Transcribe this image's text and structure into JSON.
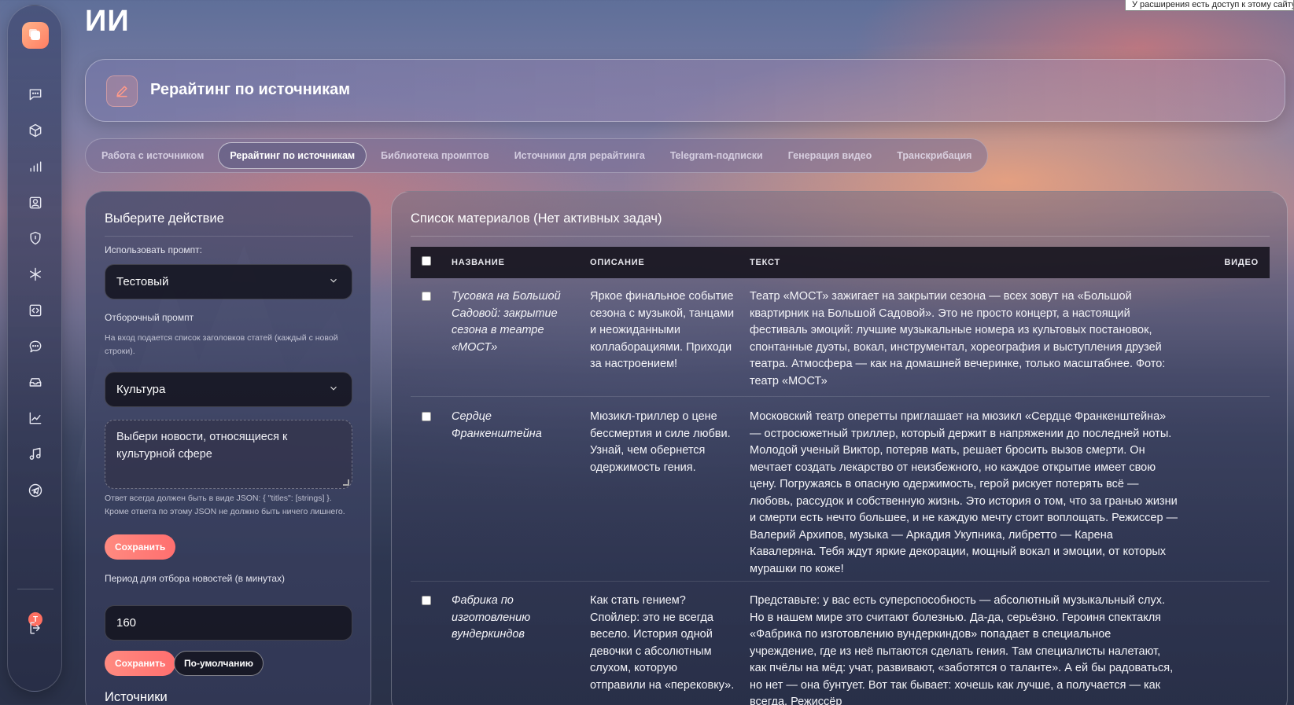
{
  "extension_banner": "У расширения есть доступ к этому сайту",
  "app": {
    "title": "ИИ"
  },
  "header": {
    "title": "Рерайтинг по источникам"
  },
  "tabs": [
    {
      "label": "Работа с источником"
    },
    {
      "label": "Рерайтинг по источникам",
      "active": true
    },
    {
      "label": "Библиотека промптов"
    },
    {
      "label": "Источники для рерайтинга"
    },
    {
      "label": "Telegram-подписки"
    },
    {
      "label": "Генерация видео"
    },
    {
      "label": "Транскрибация"
    }
  ],
  "sidebar": {
    "avatar_letter": "T",
    "icons": [
      "chat-icon",
      "cube-icon",
      "bar-chart-icon",
      "user-card-icon",
      "shield-icon",
      "asterisk-icon",
      "code-icon",
      "message-icon",
      "inbox-icon",
      "trend-chart-icon",
      "music-icon",
      "telegram-icon",
      "logout-icon"
    ]
  },
  "left_panel": {
    "title": "Выберите действие",
    "prompt_label": "Использовать промпт:",
    "prompt_value": "Тестовый",
    "filter_label": "Отборочный промпт",
    "filter_help": "На вход подается список заголовков статей (каждый с новой строки).",
    "filter_value": "Культура",
    "filter_text": "Выбери новости, относящиеся к культурной сфере",
    "json_help": "Ответ всегда должен быть в виде JSON: { \"titles\": [strings] }. Кроме ответа по этому JSON не должно быть ничего лишнего.",
    "save_label": "Сохранить",
    "period_label": "Период для отбора новостей (в минутах)",
    "period_value": "160",
    "save2_label": "Сохранить",
    "default_label": "По-умолчанию",
    "sources_title": "Источники"
  },
  "right_panel": {
    "title": "Список материалов (Нет активных задач)",
    "columns": {
      "name": "НАЗВАНИЕ",
      "description": "ОПИСАНИЕ",
      "text": "ТЕКСТ",
      "video": "ВИДЕО"
    },
    "rows": [
      {
        "name": "Тусовка на Большой Садовой: закрытие сезона в театре «МОСТ»",
        "description": "Яркое финальное событие сезона с музыкой, танцами и неожиданными коллаборациями. Приходи за настроением!",
        "text": "Театр «МОСТ» зажигает на закрытии сезона — всех зовут на «Большой квартирник на Большой Садовой». Это не просто концерт, а настоящий фестиваль эмоций: лучшие музыкальные номера из культовых постановок, спонтанные дуэты, вокал, инструментал, хореография и выступления друзей театра. Атмосфера — как на домашней вечеринке, только масштабнее. Фото: театр «МОСТ»"
      },
      {
        "name": "Сердце Франкенштейна",
        "description": "Мюзикл-триллер о цене бессмертия и силе любви. Узнай, чем обернется одержимость гения.",
        "text": "Московский театр оперетты приглашает на мюзикл «Сердце Франкенштейна» — остросюжетный триллер, который держит в напряжении до последней ноты. Молодой ученый Виктор, потеряв мать, решает бросить вызов смерти. Он мечтает создать лекарство от неизбежного, но каждое открытие имеет свою цену. Погружаясь в опасную одержимость, герой рискует потерять всё — любовь, рассудок и собственную жизнь. Это история о том, что за гранью жизни и смерти есть нечто большее, и не каждую мечту стоит воплощать. Режиссер — Валерий Архипов, музыка — Аркадия Укупника, либретто — Карена Кавалеряна. Тебя ждут яркие декорации, мощный вокал и эмоции, от которых мурашки по коже!"
      },
      {
        "name": "Фабрика по изготовлению вундеркиндов",
        "description": "Как стать гением? Спойлер: это не всегда весело. История одной девочки с абсолютным слухом, которую отправили на «перековку».",
        "text": "Представьте: у вас есть суперспособность — абсолютный музыкальный слух. Но в нашем мире это считают болезнью. Да-да, серьёзно. Героиня спектакля «Фабрика по изготовлению вундеркиндов» попадает в специальное учреждение, где из неё пытаются сделать гения. Там специалисты налетают, как пчёлы на мёд: учат, развивают, «заботятся о таланте». А ей бы радоваться, но нет — она бунтует. Вот так бывает: хочешь как лучше, а получается — как всегда. Режиссёр"
      }
    ]
  }
}
